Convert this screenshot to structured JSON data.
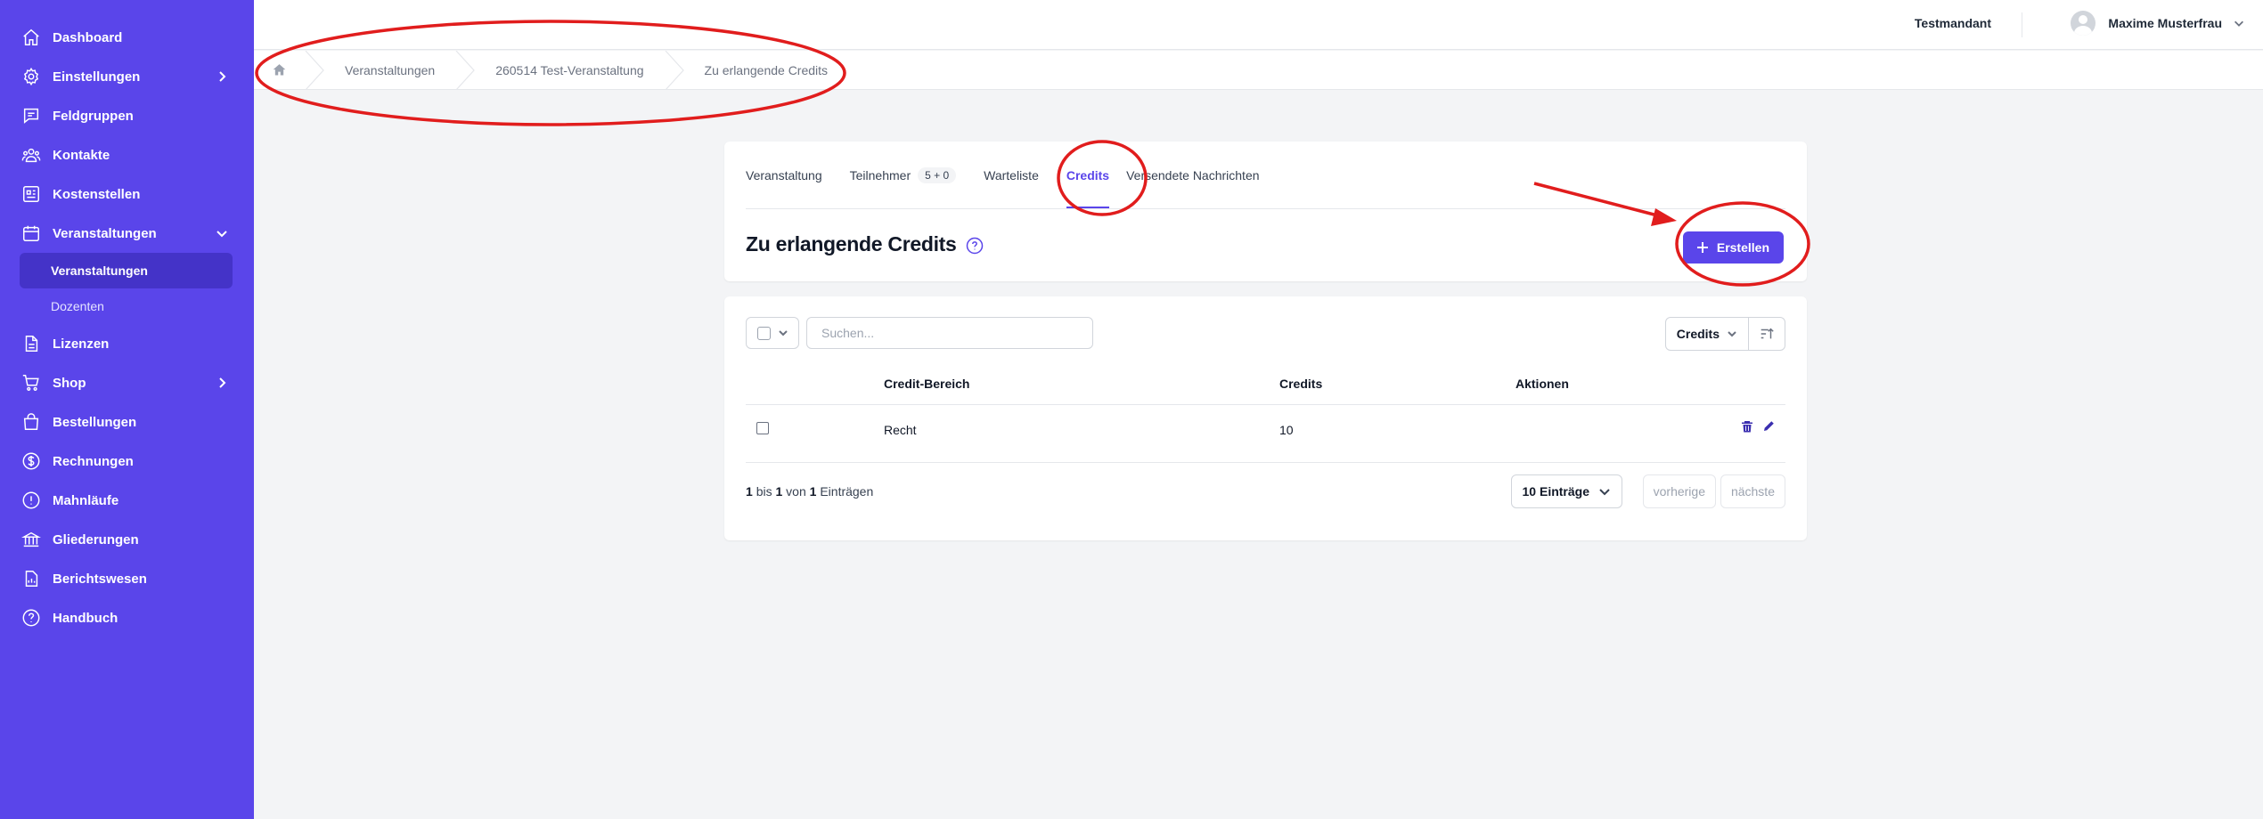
{
  "sidebar": {
    "items": [
      {
        "label": "Dashboard",
        "icon": "home-icon"
      },
      {
        "label": "Einstellungen",
        "icon": "gear-icon",
        "expandable": true
      },
      {
        "label": "Feldgruppen",
        "icon": "chat-icon"
      },
      {
        "label": "Kontakte",
        "icon": "users-icon"
      },
      {
        "label": "Kostenstellen",
        "icon": "building-icon"
      },
      {
        "label": "Veranstaltungen",
        "icon": "calendar-icon",
        "expanded": true,
        "children": [
          {
            "label": "Veranstaltungen",
            "active": true
          },
          {
            "label": "Dozenten"
          }
        ]
      },
      {
        "label": "Lizenzen",
        "icon": "document-icon"
      },
      {
        "label": "Shop",
        "icon": "cart-icon",
        "expandable": true
      },
      {
        "label": "Bestellungen",
        "icon": "bag-icon"
      },
      {
        "label": "Rechnungen",
        "icon": "dollar-icon"
      },
      {
        "label": "Mahnläufe",
        "icon": "alert-icon"
      },
      {
        "label": "Gliederungen",
        "icon": "library-icon"
      },
      {
        "label": "Berichtswesen",
        "icon": "report-icon"
      },
      {
        "label": "Handbuch",
        "icon": "help-icon"
      }
    ]
  },
  "topbar": {
    "tenant": "Testmandant",
    "user": "Maxime Musterfrau"
  },
  "breadcrumb": [
    "Veranstaltungen",
    "260514 Test-Veranstaltung",
    "Zu erlangende Credits"
  ],
  "tabs": [
    {
      "label": "Veranstaltung"
    },
    {
      "label": "Teilnehmer",
      "badge": "5 + 0"
    },
    {
      "label": "Warteliste"
    },
    {
      "label": "Credits",
      "active": true
    },
    {
      "label": "Versendete Nachrichten"
    }
  ],
  "page": {
    "title": "Zu erlangende Credits",
    "create_label": "Erstellen"
  },
  "table": {
    "search_placeholder": "Suchen...",
    "sort_field": "Credits",
    "columns": [
      "Credit-Bereich",
      "Credits",
      "Aktionen"
    ],
    "rows": [
      {
        "bereich": "Recht",
        "credits": "10"
      }
    ]
  },
  "paging": {
    "from": "1",
    "to": "1",
    "total": "1",
    "text_bis": "bis",
    "text_von": "von",
    "text_entries": "Einträgen",
    "per_page": "10 Einträge",
    "prev": "vorherige",
    "next": "nächste"
  },
  "colors": {
    "accent": "#5a45ea",
    "annotation": "#e11d1d"
  }
}
